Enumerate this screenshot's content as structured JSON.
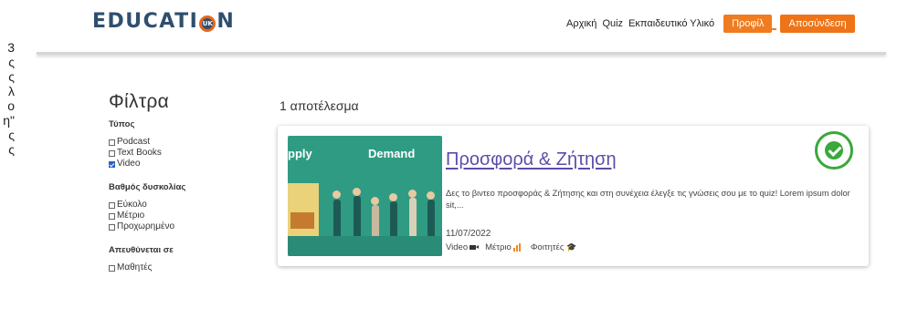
{
  "clipped_column": [
    "3",
    "ς",
    "ς",
    "λ",
    "ο",
    "η\"",
    "ς",
    "ς"
  ],
  "header": {
    "logo_text_prefix": "EDUCATI",
    "logo_text_suffix": "N",
    "logo_badge": "UK",
    "nav_links": [
      "Αρχική",
      "Quiz",
      "Εκπαιδευτικό Υλικό"
    ],
    "profile_label": "Προφίλ",
    "logout_label": "Αποσύνδεση"
  },
  "filters": {
    "title": "Φίλτρα",
    "groups": [
      {
        "title": "Τύπος",
        "options": [
          {
            "label": "Podcast",
            "checked": false
          },
          {
            "label": "Text Books",
            "checked": false
          },
          {
            "label": "Video",
            "checked": true
          }
        ]
      },
      {
        "title": "Βαθμός δυσκολίας",
        "options": [
          {
            "label": "Εύκολο",
            "checked": false
          },
          {
            "label": "Μέτριο",
            "checked": false
          },
          {
            "label": "Προχωρημένο",
            "checked": false
          }
        ]
      },
      {
        "title": "Απευθύνεται σε",
        "options": [
          {
            "label": "Μαθητές",
            "checked": false
          }
        ]
      }
    ]
  },
  "results": {
    "count_label": "1 αποτέλεσμα",
    "items": [
      {
        "thumb_text_left": "pply",
        "thumb_text_right": "Demand",
        "title": "Προσφορά & Ζήτηση",
        "description": "Δες το βιντεο προσφοράς & Ζήτησης και στη συνέχεια έλεγξε τις γνώσεις σου με το quiz! Lorem ipsum dolor sit,...",
        "date": "11/07/2022",
        "type": "Video",
        "difficulty": "Μέτριο",
        "audience": "Φοιτητές",
        "badge": "recommended-badge",
        "badge_color": "#3aa83b"
      }
    ]
  },
  "colors": {
    "accent": "#f07c1f",
    "title_link": "#5a4ea8",
    "logo": "#2f4f6f"
  }
}
